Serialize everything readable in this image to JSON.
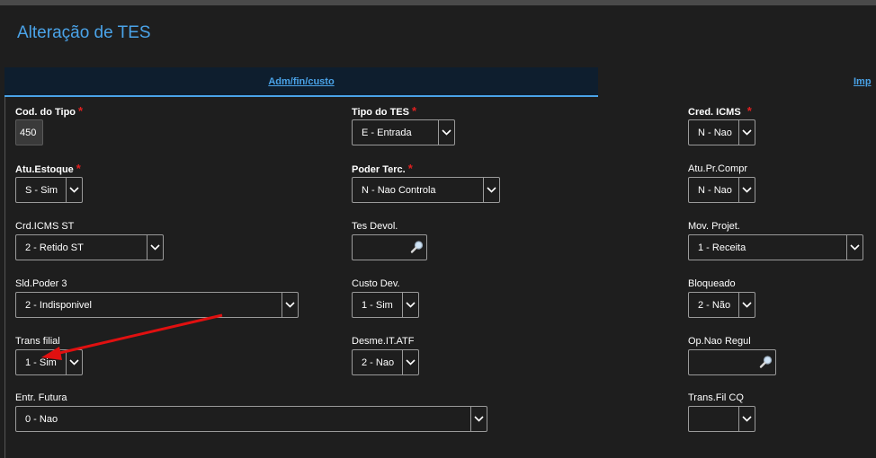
{
  "page": {
    "title": "Alteração de TES"
  },
  "tabs": [
    {
      "label": "Adm/fin/custo",
      "active": true
    },
    {
      "label": "Imp",
      "active": false
    }
  ],
  "fields": {
    "cod_tipo": {
      "label": "Cod. do Tipo",
      "value": "450",
      "required": "*"
    },
    "tipo_tes": {
      "label": "Tipo do TES",
      "value": "E - Entrada",
      "required": "*"
    },
    "cred_icms": {
      "label": "Cred. ICMS",
      "value": "N - Nao",
      "required": "*"
    },
    "atu_estoque": {
      "label": "Atu.Estoque",
      "value": "S - Sim",
      "required": "*"
    },
    "poder_terc": {
      "label": "Poder Terc.",
      "value": "N - Nao Controla",
      "required": "*"
    },
    "atu_pr_compr": {
      "label": "Atu.Pr.Compr",
      "value": "N - Nao"
    },
    "crd_icms_st": {
      "label": "Crd.ICMS ST",
      "value": "2 - Retido ST"
    },
    "tes_devol": {
      "label": "Tes Devol.",
      "value": ""
    },
    "mov_projet": {
      "label": "Mov. Projet.",
      "value": "1 - Receita"
    },
    "sld_poder3": {
      "label": "Sld.Poder 3",
      "value": "2 - Indisponivel"
    },
    "custo_dev": {
      "label": "Custo Dev.",
      "value": "1 - Sim"
    },
    "bloqueado": {
      "label": "Bloqueado",
      "value": "2 - Não"
    },
    "trans_filial": {
      "label": "Trans filial",
      "value": "1 - Sim"
    },
    "desme_it_atf": {
      "label": "Desme.IT.ATF",
      "value": "2 - Nao"
    },
    "op_nao_regul": {
      "label": "Op.Nao Regul",
      "value": ""
    },
    "entr_futura": {
      "label": "Entr. Futura",
      "value": "0 - Nao"
    },
    "trans_fil_cq": {
      "label": "Trans.Fil CQ",
      "value": ""
    }
  },
  "colors": {
    "accent": "#4aa3e8",
    "required": "#e02020",
    "annotation_arrow": "#e01010"
  }
}
